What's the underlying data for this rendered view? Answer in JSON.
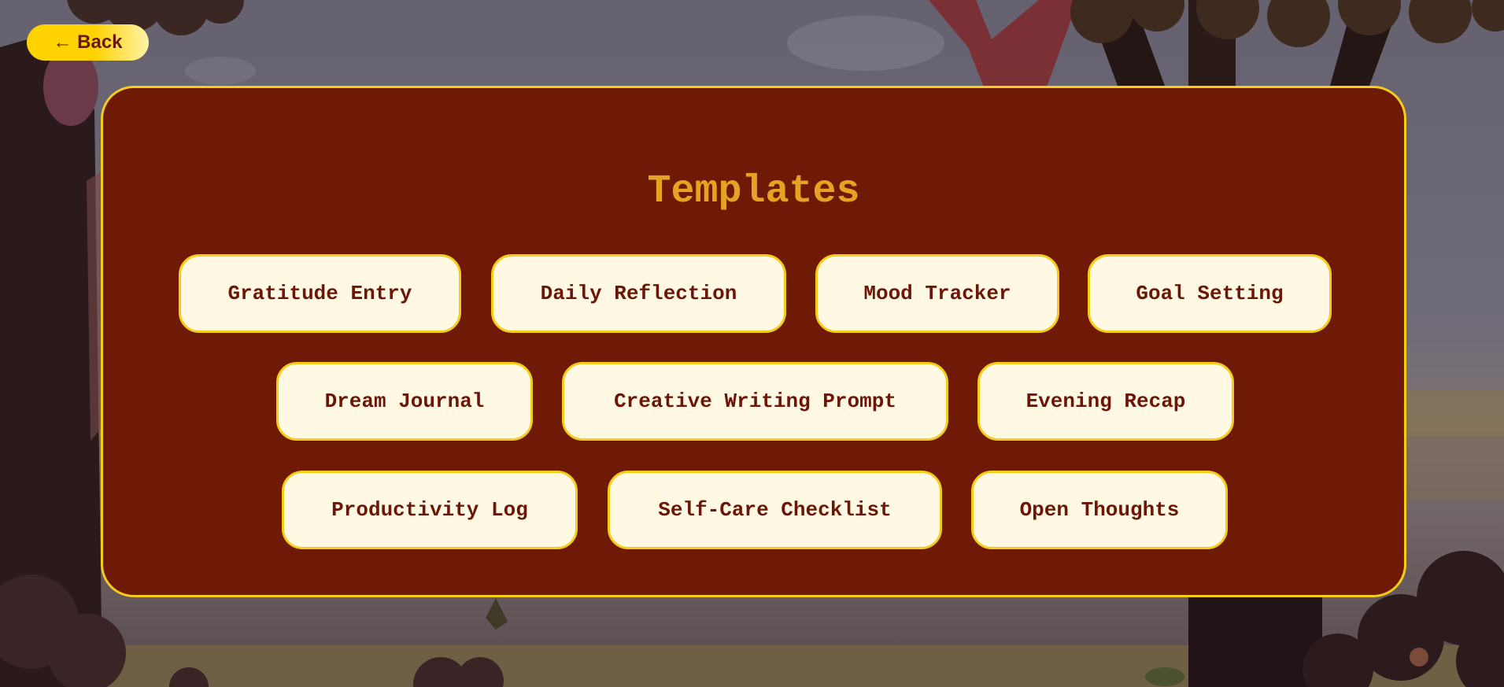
{
  "back_button": {
    "label": "← Back"
  },
  "panel": {
    "title": "Templates"
  },
  "templates": [
    {
      "label": "Gratitude Entry"
    },
    {
      "label": "Daily Reflection"
    },
    {
      "label": "Mood Tracker"
    },
    {
      "label": "Goal Setting"
    },
    {
      "label": "Dream Journal"
    },
    {
      "label": "Creative Writing Prompt"
    },
    {
      "label": "Evening Recap"
    },
    {
      "label": "Productivity Log"
    },
    {
      "label": "Self-Care Checklist"
    },
    {
      "label": "Open Thoughts"
    }
  ],
  "colors": {
    "panel_bg": "#6e1a07",
    "panel_border": "#f5cc19",
    "title": "#e6a323",
    "button_bg": "#fff9e4",
    "button_text": "#6b1607",
    "back_button": "#ffd200"
  }
}
